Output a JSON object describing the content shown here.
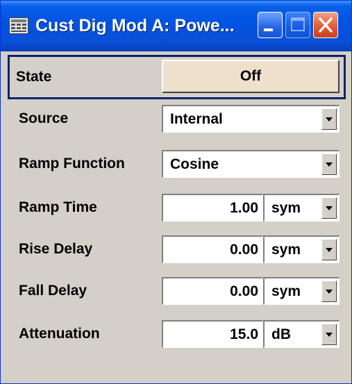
{
  "window": {
    "title": "Cust Dig Mod  A: Powe..."
  },
  "state": {
    "label": "State",
    "value": "Off"
  },
  "rows": {
    "source": {
      "label": "Source",
      "value": "Internal"
    },
    "ramp_function": {
      "label": "Ramp Function",
      "value": "Cosine"
    },
    "ramp_time": {
      "label": "Ramp Time",
      "value": "1.00",
      "unit": "sym"
    },
    "rise_delay": {
      "label": "Rise Delay",
      "value": "0.00",
      "unit": "sym"
    },
    "fall_delay": {
      "label": "Fall Delay",
      "value": "0.00",
      "unit": "sym"
    },
    "attenuation": {
      "label": "Attenuation",
      "value": "15.0",
      "unit": "dB"
    }
  },
  "icons": {
    "app": "app-window-icon",
    "minimize": "minimize-icon",
    "maximize": "maximize-icon",
    "close": "close-icon",
    "dropdown": "chevron-down-icon"
  },
  "colors": {
    "titlebar": "#0054e3",
    "state_button": "#efe0cc",
    "panel": "#d4d0c8",
    "close": "#e35a36"
  }
}
